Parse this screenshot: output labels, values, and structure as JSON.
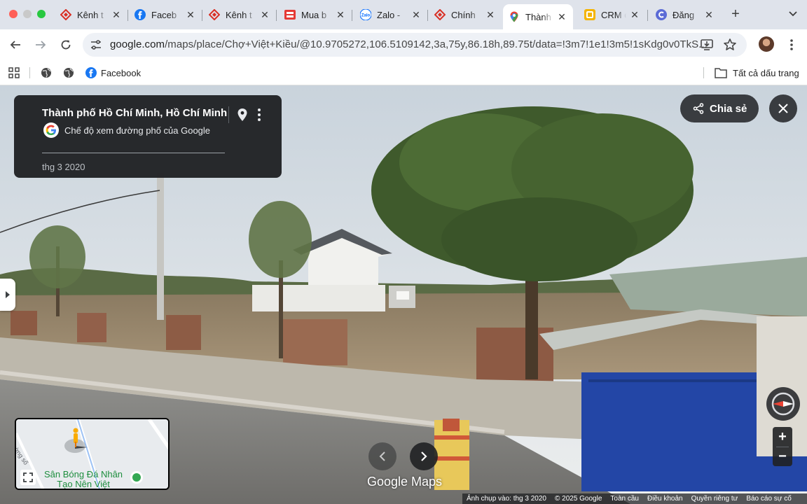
{
  "browser": {
    "tabs": [
      {
        "title": "Kênh t",
        "favicon": "red-diamond-icon"
      },
      {
        "title": "Faceb",
        "favicon": "facebook-icon"
      },
      {
        "title": "Kênh t",
        "favicon": "red-diamond-icon"
      },
      {
        "title": "Mua b",
        "favicon": "shop-icon"
      },
      {
        "title": "Zalo -",
        "favicon": "zalo-icon"
      },
      {
        "title": "Chính",
        "favicon": "red-diamond-icon"
      },
      {
        "title": "Thành",
        "favicon": "maps-pin-icon",
        "active": true
      },
      {
        "title": "CRM c",
        "favicon": "crm-icon"
      },
      {
        "title": "Đăng",
        "favicon": "c-logo-icon"
      }
    ],
    "url_host": "google.com",
    "url_path": "/maps/place/Chợ+Việt+Kiều/@10.9705272,106.5109142,3a,75y,86.18h,89.75t/data=!3m7!1e1!3m5!1sKdg0v0TkS...",
    "bookmarks": [
      {
        "label": "",
        "icon": "globe-icon"
      },
      {
        "label": "",
        "icon": "globe-icon"
      },
      {
        "label": "Facebook",
        "icon": "facebook-icon"
      }
    ],
    "all_bookmarks_label": "Tất cả dấu trang"
  },
  "streetview": {
    "location_title": "Thành phố Hồ Chí Minh, Hồ Chí Minh",
    "mode_label": "Chế độ xem đường phố của Google",
    "capture_date": "thg 3 2020",
    "share_label": "Chia sẻ",
    "logo_text": "Google Maps",
    "minimap": {
      "poi_label_line1": "Sân Bóng Đá Nhân",
      "poi_label_line2": "Tạo Nên Việt",
      "road_label": "Đường số"
    },
    "footer": [
      "Ảnh chụp vào: thg 3 2020",
      "© 2025 Google",
      "Toàn cầu",
      "Điều khoản",
      "Quyền riêng tư",
      "Báo cáo sự cố"
    ]
  },
  "colors": {
    "tabstrip_bg": "#dfe3eb",
    "omnibox_bg": "#eef1f6",
    "panel_bg": "#202124",
    "accent_green": "#34a853"
  }
}
